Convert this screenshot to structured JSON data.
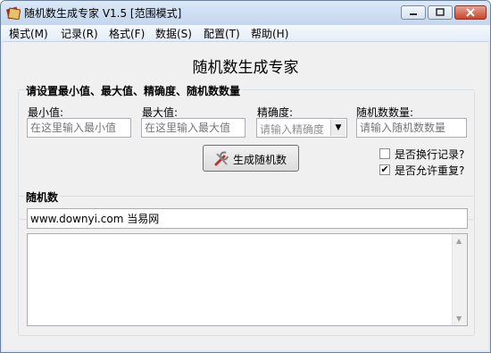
{
  "window": {
    "title": "随机数生成专家 V1.5 [范围模式]",
    "controls": [
      "minimize-icon",
      "maximize-icon",
      "close-icon"
    ]
  },
  "menu": [
    "模式(M)",
    "记录(R)",
    "格式(F)",
    "数据(S)",
    "配置(T)",
    "帮助(H)"
  ],
  "heading": "随机数生成专家",
  "settings": {
    "title": "请设置最小值、最大值、精确度、随机数数量",
    "min": {
      "label": "最小值:",
      "placeholder": "在这里输入最小值",
      "value": ""
    },
    "max": {
      "label": "最大值:",
      "placeholder": "在这里输入最大值",
      "value": ""
    },
    "precision": {
      "label": "精确度:",
      "selected": "请输入精确度"
    },
    "count": {
      "label": "随机数数量:",
      "placeholder": "请输入随机数数量",
      "value": ""
    },
    "generate_button": "生成随机数",
    "generate_icon": "tools-icon",
    "options": [
      {
        "label": "是否换行记录?",
        "checked": false
      },
      {
        "label": "是否允许重复?",
        "checked": true
      }
    ]
  },
  "results": {
    "title": "随机数",
    "input_value": "www.downyi.com 当易网",
    "output_text": ""
  },
  "colors": {
    "window_frame": "#6b7f98",
    "title_bar": "#c3d6ee",
    "close_button": "#c8462d",
    "client_bg": "#f0f0f0"
  }
}
